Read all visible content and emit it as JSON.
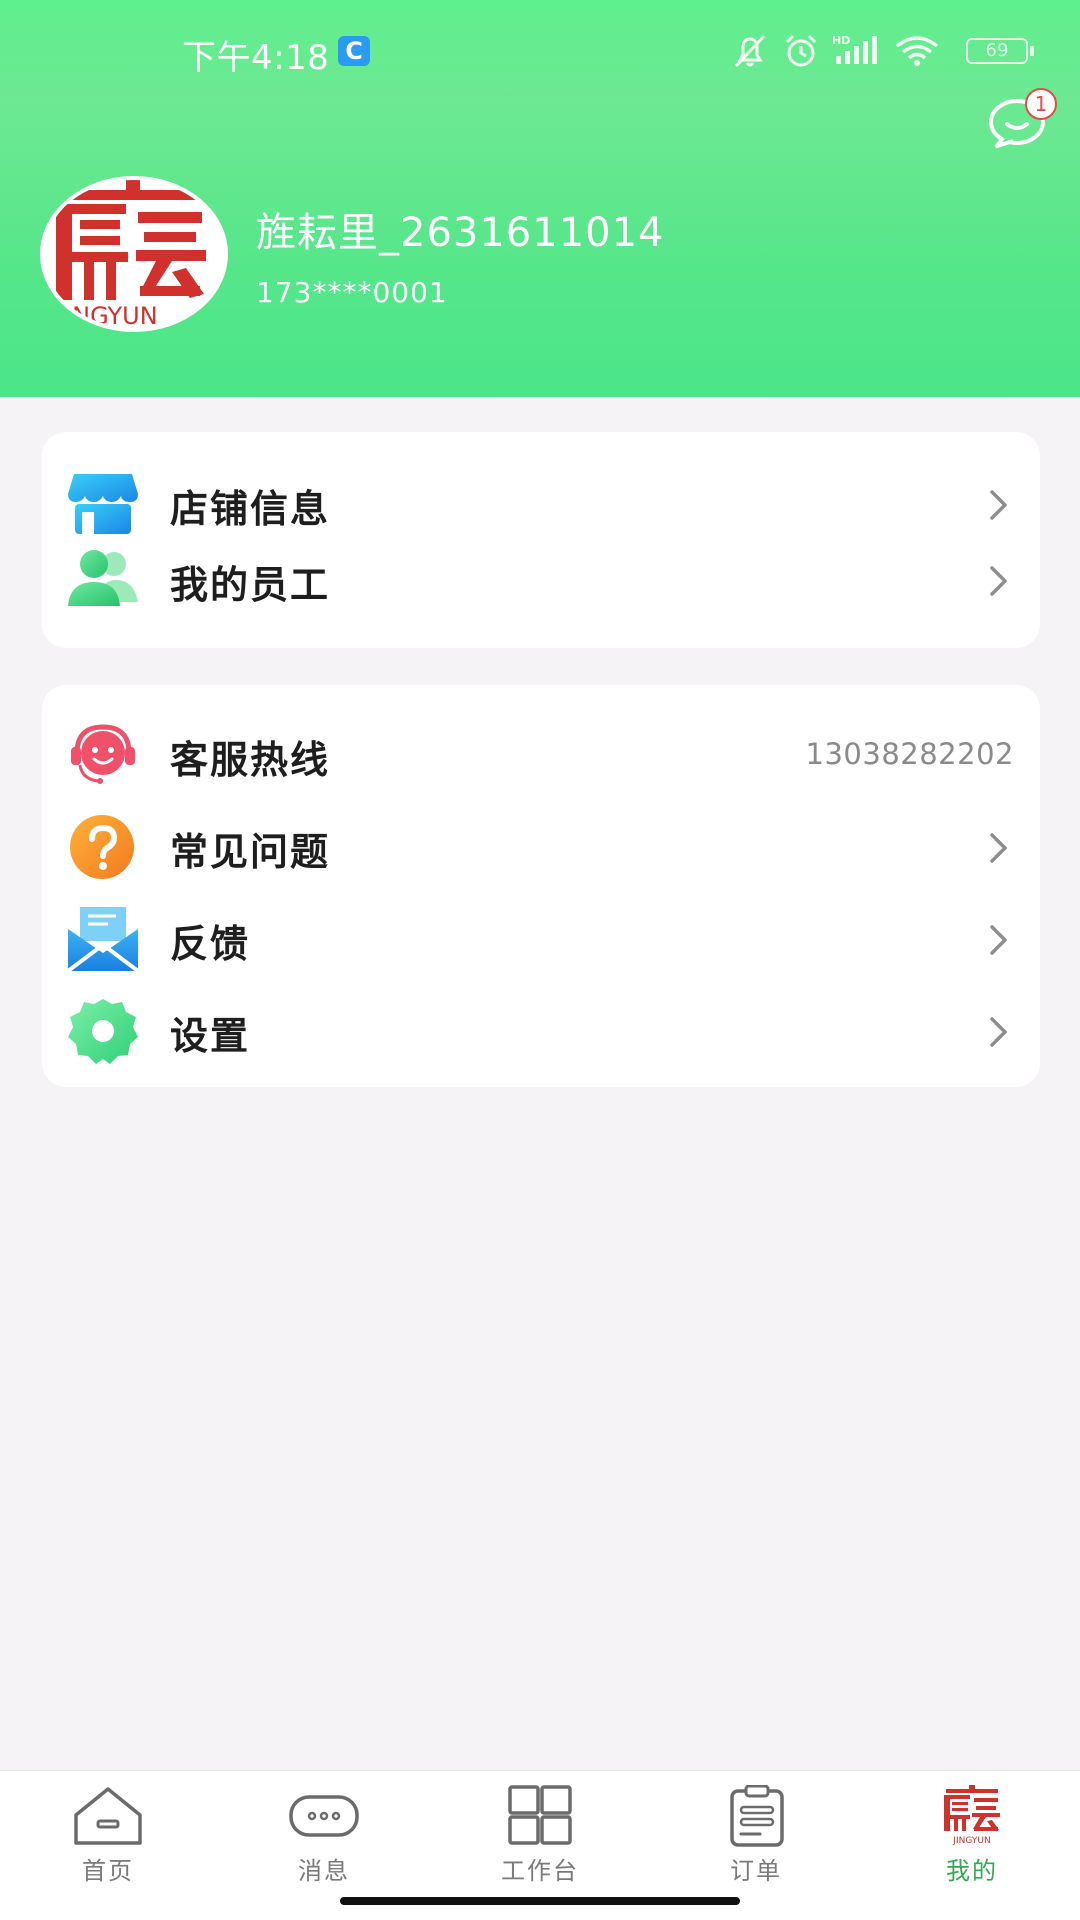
{
  "status_bar": {
    "time": "下午4:18",
    "app_badge": "C",
    "battery": "69",
    "network": "HD",
    "icons": [
      "bell-off-icon",
      "alarm-icon",
      "signal-icon",
      "wifi-icon",
      "battery-icon"
    ]
  },
  "header": {
    "message_badge_count": "1",
    "user_name": "旌耘里_2631611014",
    "user_phone": "173****0001",
    "avatar_logo_text": "JINGYUN",
    "colors": {
      "gradient_top": "#5fef8e",
      "gradient_bottom": "#4be589"
    }
  },
  "menu_group_1": [
    {
      "label": "店铺信息",
      "icon": "store-icon"
    },
    {
      "label": "我的员工",
      "icon": "staff-icon"
    }
  ],
  "menu_group_2": [
    {
      "label": "客服热线",
      "icon": "customer-service-icon",
      "value": "13038282202"
    },
    {
      "label": "常见问题",
      "icon": "faq-icon"
    },
    {
      "label": "反馈",
      "icon": "feedback-icon"
    },
    {
      "label": "设置",
      "icon": "settings-icon"
    }
  ],
  "bottom_nav": [
    {
      "label": "首页",
      "icon": "home-icon",
      "active": false
    },
    {
      "label": "消息",
      "icon": "message-icon",
      "active": false
    },
    {
      "label": "工作台",
      "icon": "workbench-icon",
      "active": false
    },
    {
      "label": "订单",
      "icon": "orders-icon",
      "active": false
    },
    {
      "label": "我的",
      "icon": "profile-logo-icon",
      "active": true,
      "logo_text": "JINGYUN"
    }
  ],
  "accent_colors": {
    "active_tab": "#3aa653",
    "logo_red": "#d0312d"
  }
}
